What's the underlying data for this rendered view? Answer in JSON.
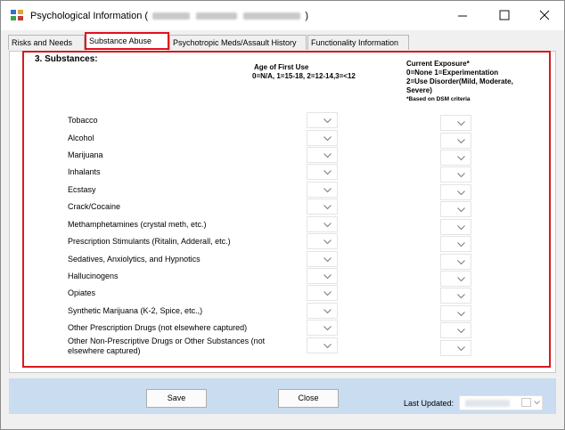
{
  "window": {
    "title_prefix": "Psychological Information (",
    "title_suffix": ")",
    "controls": {
      "minimize": "—",
      "maximize": "☐",
      "close": "✕"
    }
  },
  "tabs": [
    {
      "label": "Risks and Needs"
    },
    {
      "label": "Substance Abuse"
    },
    {
      "label": "Psychotropic Meds/Assault History"
    },
    {
      "label": "Functionality Information"
    }
  ],
  "section": {
    "title": "3. Substances:",
    "age_header_line1": "Age of First Use",
    "age_header_line2": "0=N/A, 1=15-18, 2=12-14,3=<12",
    "exposure_header_line1": "Current Exposure*",
    "exposure_header_line2": "0=None 1=Experimentation",
    "exposure_header_line3": "2=Use Disorder(Mild, Moderate,",
    "exposure_header_line4": "Severe)",
    "exposure_header_note": "*Based on DSM criteria"
  },
  "substances": [
    {
      "label": "Tobacco",
      "age": "",
      "exposure": ""
    },
    {
      "label": "Alcohol",
      "age": "",
      "exposure": ""
    },
    {
      "label": "Marijuana",
      "age": "",
      "exposure": ""
    },
    {
      "label": "Inhalants",
      "age": "",
      "exposure": ""
    },
    {
      "label": "Ecstasy",
      "age": "",
      "exposure": ""
    },
    {
      "label": "Crack/Cocaine",
      "age": "",
      "exposure": ""
    },
    {
      "label": "Methamphetamines (crystal meth, etc.)",
      "age": "",
      "exposure": ""
    },
    {
      "label": "Prescription Stimulants (Ritalin, Adderall, etc.)",
      "age": "",
      "exposure": ""
    },
    {
      "label": "Sedatives, Anxiolytics, and Hypnotics",
      "age": "",
      "exposure": ""
    },
    {
      "label": "Hallucinogens",
      "age": "",
      "exposure": ""
    },
    {
      "label": "Opiates",
      "age": "",
      "exposure": ""
    },
    {
      "label": "Synthetic Marijuana (K-2, Spice, etc.,)",
      "age": "",
      "exposure": ""
    },
    {
      "label": "Other Prescription Drugs (not elsewhere captured)",
      "age": "",
      "exposure": ""
    },
    {
      "label": "Other Non-Prescriptive Drugs or Other Substances (not",
      "label_line2": "elsewhere captured)",
      "age": "",
      "exposure": ""
    }
  ],
  "footer": {
    "save_label": "Save",
    "close_label": "Close",
    "last_updated_label": "Last Updated:"
  },
  "icons": {
    "app": "app-icon",
    "dropdown": "chevron-down-icon",
    "calendar": "calendar-icon"
  },
  "colors": {
    "annotation_red": "#d8191e",
    "footer_bg": "#c9dcf0"
  }
}
